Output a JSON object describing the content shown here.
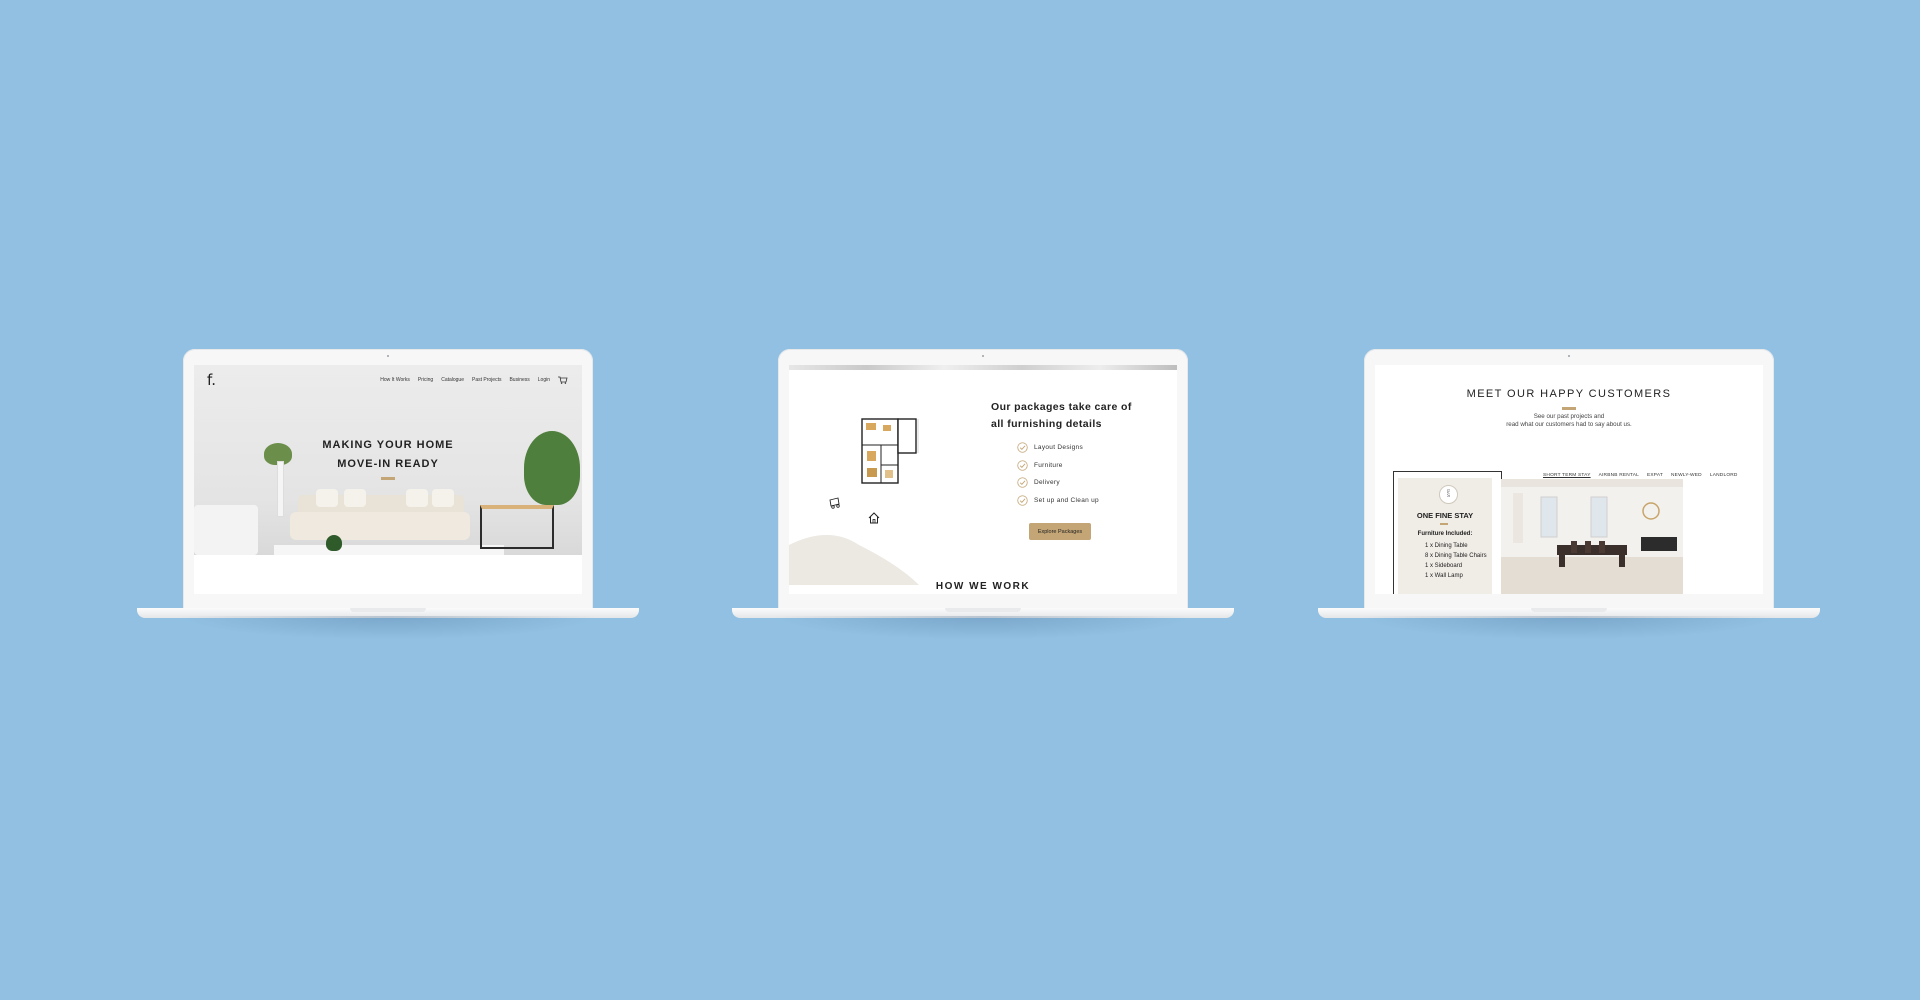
{
  "laptops": [
    {
      "nav": {
        "logo": "f.",
        "items": [
          "How It Works",
          "Pricing",
          "Catalogue",
          "Past Projects",
          "Business",
          "Login"
        ],
        "cart_icon": "shopping-cart-icon"
      },
      "hero": {
        "title_line1": "MAKING YOUR HOME",
        "title_line2": "MOVE-IN READY"
      }
    },
    {
      "packages": {
        "title_line1": "Our packages take care of",
        "title_line2": "all furnishing details",
        "items": [
          "Layout Designs",
          "Furniture",
          "Delivery",
          "Set up and Clean up"
        ],
        "button": "Explore Packages"
      },
      "how": "HOW WE WORK"
    },
    {
      "customers": {
        "title": "MEET OUR HAPPY CUSTOMERS",
        "subtitle_line1": "See our past projects and",
        "subtitle_line2": "read what our customers had to say about us.",
        "tabs": [
          "SHORT TERM STAY",
          "AIRBNB RENTAL",
          "EXPAT",
          "NEWLY-WED",
          "LANDLORD"
        ],
        "card": {
          "seal_top": "F",
          "seal_bottom": "S",
          "name": "ONE FINE STAY",
          "included_title": "Furniture Included:",
          "items": [
            "1  x  Dining Table",
            "8  x  Dining Table Chairs",
            "1  x  Sideboard",
            "1  x  Wall Lamp"
          ]
        }
      }
    }
  ],
  "colors": {
    "background": "#91c0e2",
    "accent_gold": "#c4a676",
    "text_dark": "#222222"
  }
}
